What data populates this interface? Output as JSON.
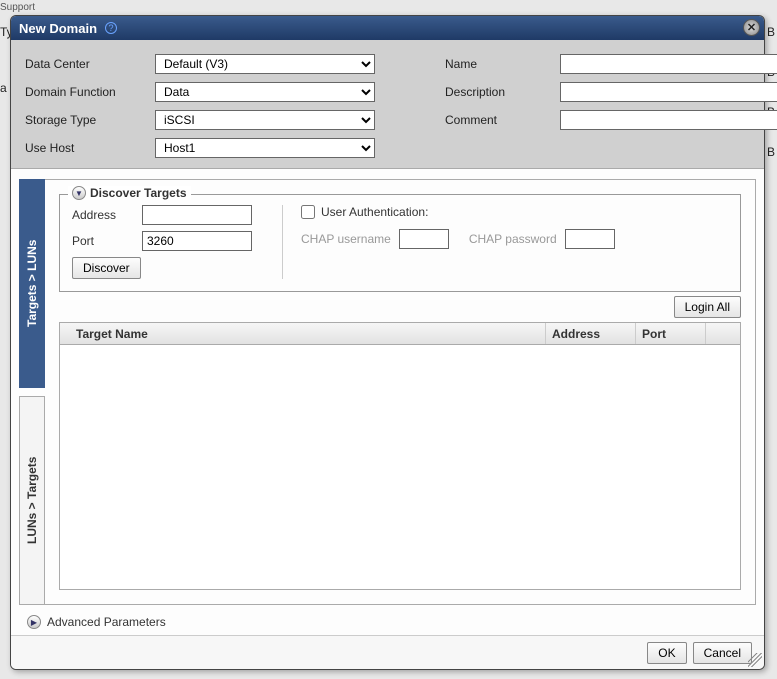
{
  "background": {
    "support": "Support",
    "left1": "Ty",
    "left2": "a",
    "rightB": "B"
  },
  "dialog": {
    "title": "New Domain",
    "form": {
      "data_center_label": "Data Center",
      "data_center_value": "Default (V3)",
      "domain_function_label": "Domain Function",
      "domain_function_value": "Data",
      "storage_type_label": "Storage Type",
      "storage_type_value": "iSCSI",
      "use_host_label": "Use Host",
      "use_host_value": "Host1",
      "name_label": "Name",
      "name_value": "",
      "description_label": "Description",
      "description_value": "",
      "comment_label": "Comment",
      "comment_value": ""
    },
    "tabs": {
      "targets_luns": "Targets > LUNs",
      "luns_targets": "LUNs > Targets"
    },
    "discover": {
      "legend": "Discover Targets",
      "address_label": "Address",
      "address_value": "",
      "port_label": "Port",
      "port_value": "3260",
      "discover_btn": "Discover",
      "user_auth_label": "User Authentication:",
      "chap_user_label": "CHAP username",
      "chap_pass_label": "CHAP password"
    },
    "targets_table": {
      "login_all_btn": "Login All",
      "col_name": "Target Name",
      "col_address": "Address",
      "col_port": "Port"
    },
    "advanced_label": "Advanced Parameters",
    "buttons": {
      "ok": "OK",
      "cancel": "Cancel"
    }
  }
}
